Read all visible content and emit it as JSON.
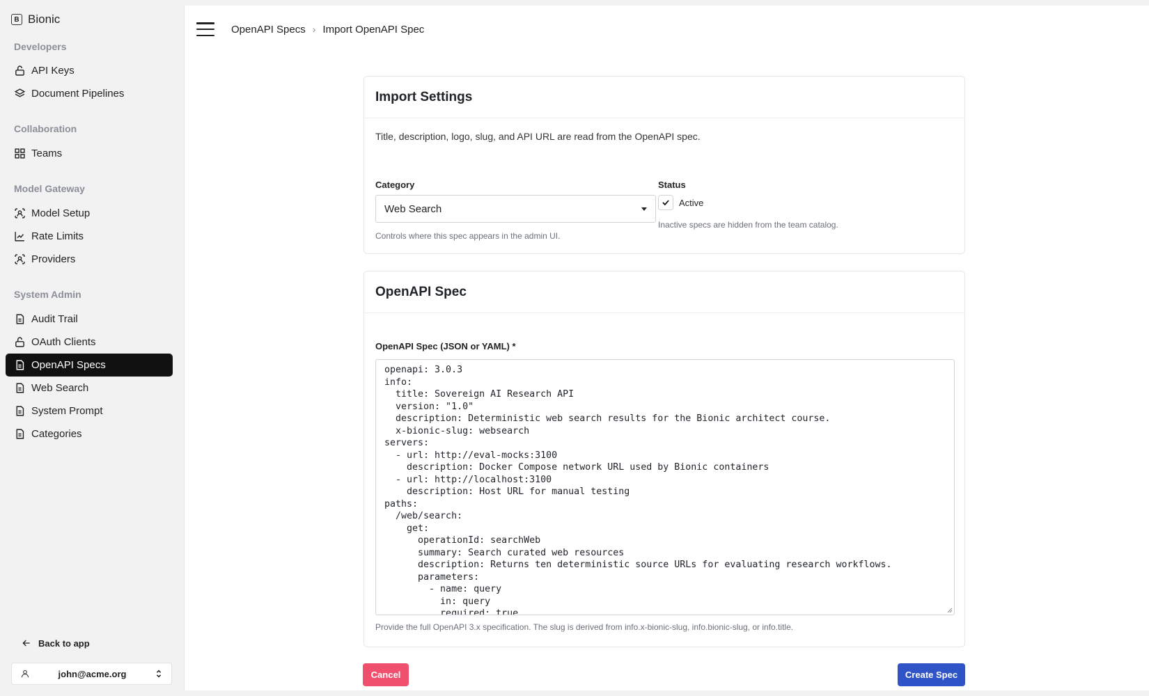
{
  "app": {
    "name": "Bionic",
    "logo_letter": "B"
  },
  "sidebar": {
    "sections": [
      {
        "title": "Developers",
        "items": [
          {
            "label": "API Keys",
            "icon": "lock-icon"
          },
          {
            "label": "Document Pipelines",
            "icon": "layers-icon"
          }
        ]
      },
      {
        "title": "Collaboration",
        "items": [
          {
            "label": "Teams",
            "icon": "grid-icon"
          }
        ]
      },
      {
        "title": "Model Gateway",
        "items": [
          {
            "label": "Model Setup",
            "icon": "scan-face-icon"
          },
          {
            "label": "Rate Limits",
            "icon": "line-chart-icon"
          },
          {
            "label": "Providers",
            "icon": "scan-face-icon"
          }
        ]
      },
      {
        "title": "System Admin",
        "items": [
          {
            "label": "Audit Trail",
            "icon": "file-icon"
          },
          {
            "label": "OAuth Clients",
            "icon": "lock-icon"
          },
          {
            "label": "OpenAPI Specs",
            "icon": "file-icon",
            "active": true
          },
          {
            "label": "Web Search",
            "icon": "file-icon"
          },
          {
            "label": "System Prompt",
            "icon": "file-icon"
          },
          {
            "label": "Categories",
            "icon": "file-icon"
          }
        ]
      }
    ],
    "back_label": "Back to app",
    "user_email": "john@acme.org"
  },
  "breadcrumb": {
    "parent": "OpenAPI Specs",
    "current": "Import OpenAPI Spec"
  },
  "import_settings": {
    "title": "Import Settings",
    "description": "Title, description, logo, slug, and API URL are read from the OpenAPI spec.",
    "category_label": "Category",
    "category_value": "Web Search",
    "category_help": "Controls where this spec appears in the admin UI.",
    "status_label": "Status",
    "active_label": "Active",
    "active_checked": true,
    "status_help": "Inactive specs are hidden from the team catalog."
  },
  "openapi_spec": {
    "title": "OpenAPI Spec",
    "field_label": "OpenAPI Spec (JSON or YAML) *",
    "help": "Provide the full OpenAPI 3.x specification. The slug is derived from info.x-bionic-slug, info.bionic-slug, or info.title.",
    "lines": [
      "openapi: 3.0.3",
      "info:",
      "  title: Sovereign AI Research API",
      "  version: \"1.0\"",
      "  description: Deterministic web search results for the Bionic architect course.",
      "  x-bionic-slug: websearch",
      "servers:",
      "  - url: http://eval-mocks:3100",
      "    description: Docker Compose network URL used by Bionic containers",
      "  - url: http://localhost:3100",
      "    description: Host URL for manual testing",
      "paths:",
      "  /web/search:",
      "    get:",
      "      operationId: searchWeb",
      "      summary: Search curated web resources",
      "      description: Returns ten deterministic source URLs for evaluating research workflows.",
      "      parameters:",
      "        - name: query",
      "          in: query",
      "          required: true"
    ]
  },
  "actions": {
    "cancel": "Cancel",
    "create": "Create Spec"
  },
  "colors": {
    "active_nav": "#111111",
    "cancel": "#f0506e",
    "primary": "#2f54c8"
  }
}
